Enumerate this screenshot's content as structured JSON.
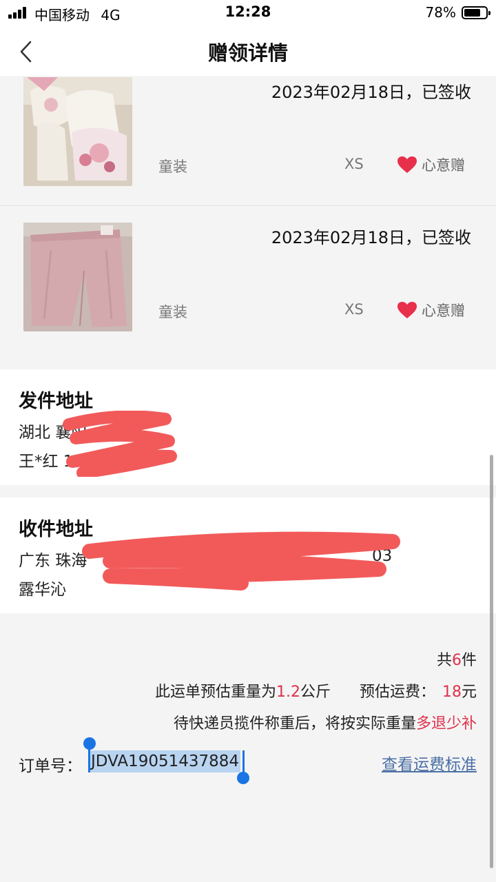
{
  "status_bar": {
    "carrier": "中国移动",
    "network": "4G",
    "time": "12:28",
    "battery": "78%",
    "battery_level": 0.78
  },
  "nav": {
    "title": "赠领详情",
    "back_icon": "chevron-left-icon"
  },
  "items": [
    {
      "date": "2023年02月18日，已签收",
      "category": "童装",
      "size": "XS",
      "wish_label": "心意赠",
      "photo": "baby-clothes-photo"
    },
    {
      "date": "2023年02月18日，已签收",
      "category": "童装",
      "size": "XS",
      "wish_label": "心意赠",
      "photo": "pink-pants-photo"
    }
  ],
  "sender": {
    "title": "发件地址",
    "line1": "湖北 襄阳",
    "line2": "王*红 158*"
  },
  "receiver": {
    "title": "收件地址",
    "line1": "广东 珠海",
    "line1_tail": "03",
    "line2": "露华沁"
  },
  "summary": {
    "total_prefix": "共",
    "total_count": "6",
    "total_suffix": "件",
    "weight_prefix": "此运单预估重量为",
    "weight_value": "1.2",
    "weight_unit": "公斤",
    "fee_prefix": "预估运费：",
    "fee_value": "18",
    "fee_unit": "元",
    "note_prefix": "待快递员揽件称重后，将按实际重量",
    "note_highlight": "多退少补"
  },
  "order": {
    "label": "订单号：",
    "number": "JDVA19051437884",
    "fee_link": "查看运费标准"
  },
  "colors": {
    "accent_red": "#e0314b",
    "heart_red": "#e8304b",
    "link_blue": "#4a6fa5",
    "selection": "#b9d4f0",
    "scribble": "#f25a5a"
  }
}
